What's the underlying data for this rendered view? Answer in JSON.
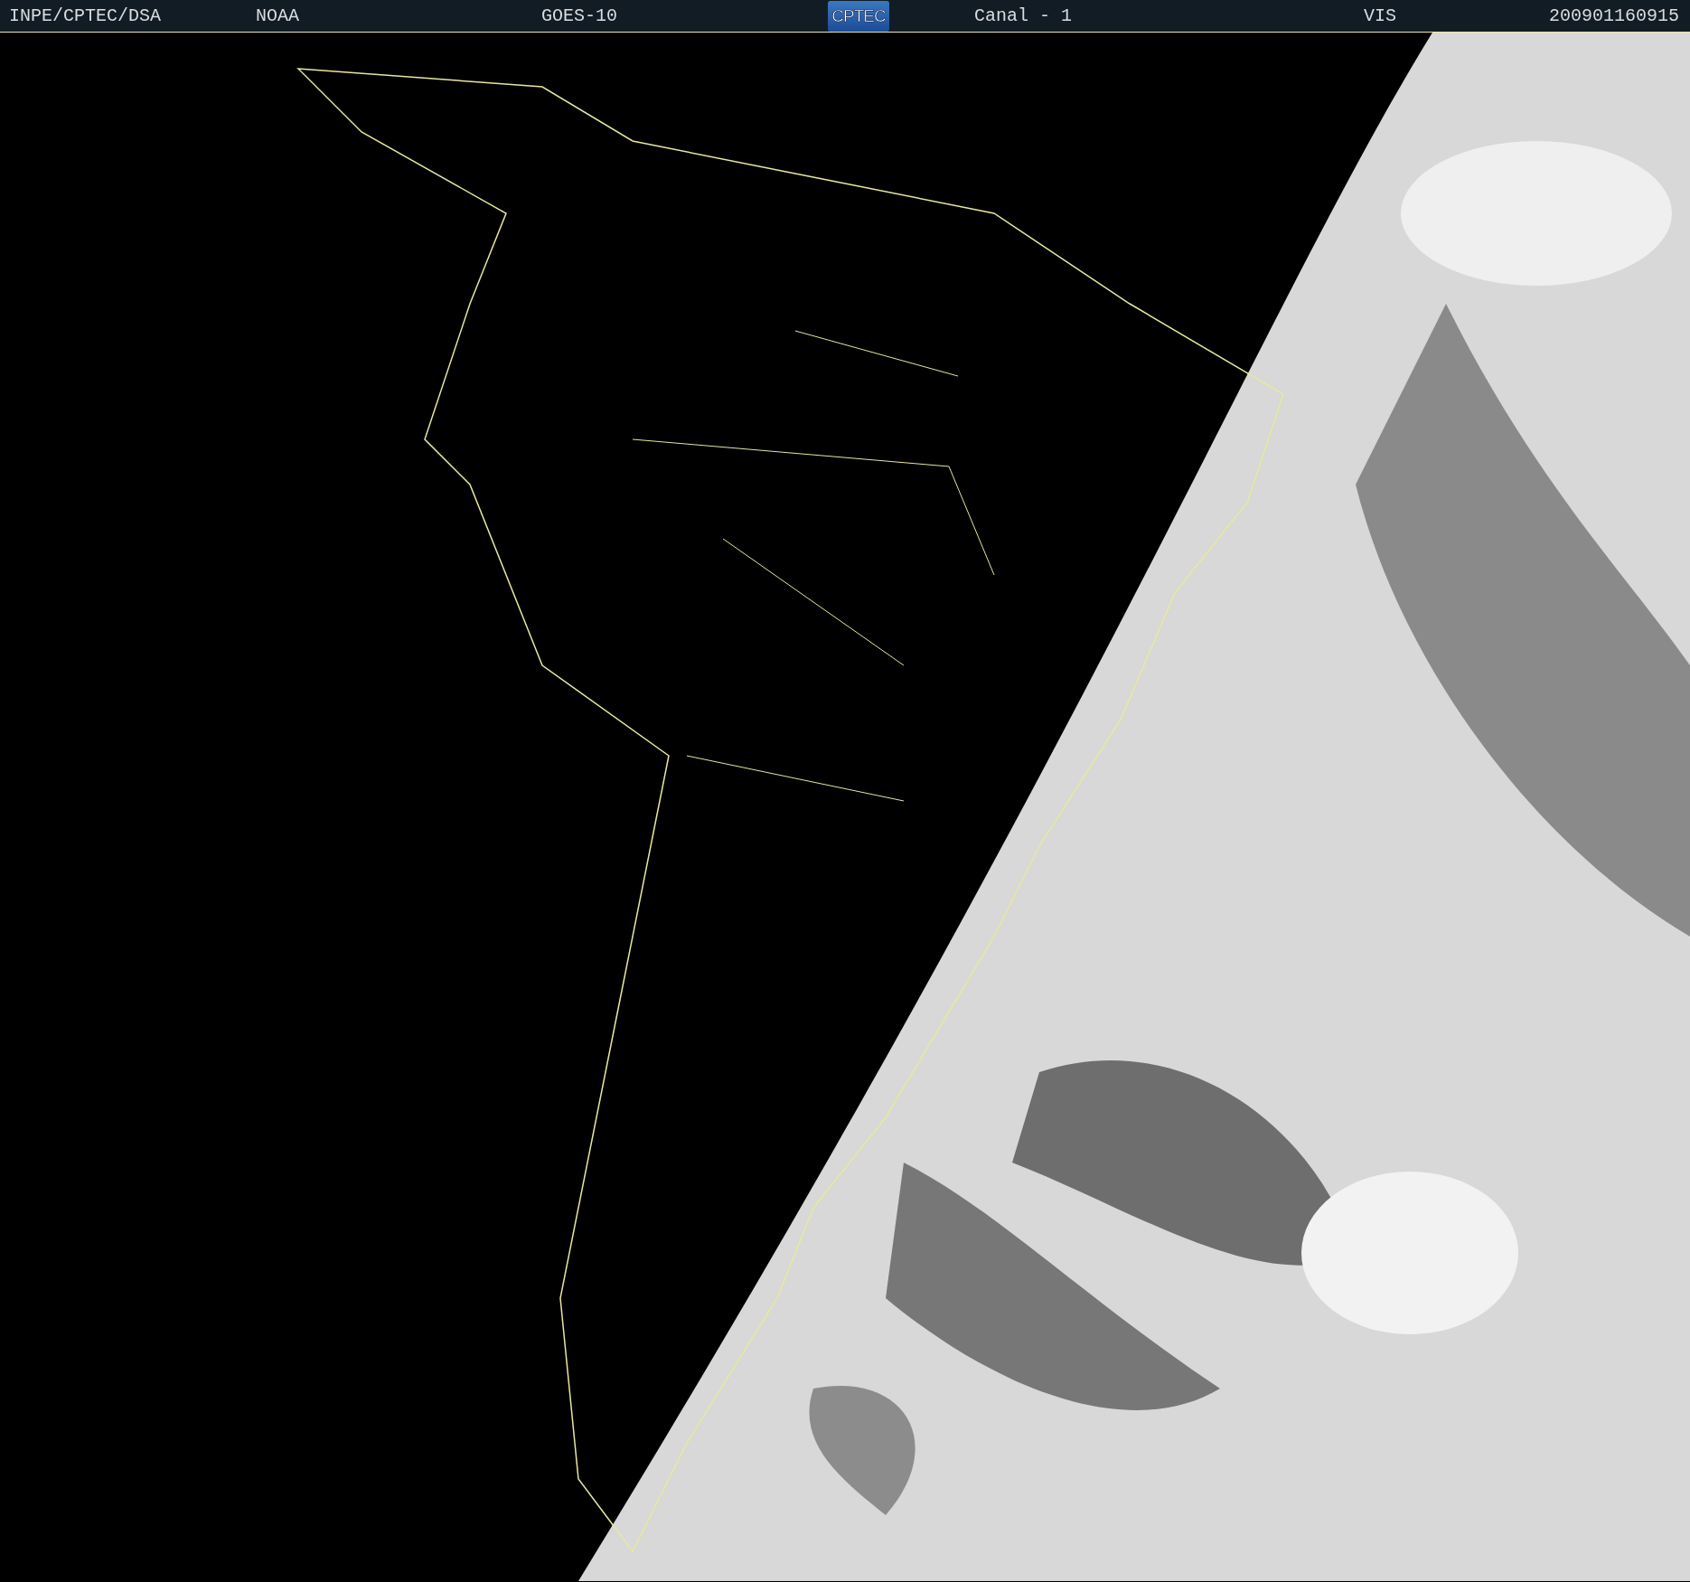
{
  "header": {
    "source": "INPE/CPTEC/DSA",
    "agency": "NOAA",
    "satellite": "GOES-10",
    "logo": "CPTEC",
    "channel": "Canal - 1",
    "band": "VIS",
    "timestamp": "200901160915"
  }
}
